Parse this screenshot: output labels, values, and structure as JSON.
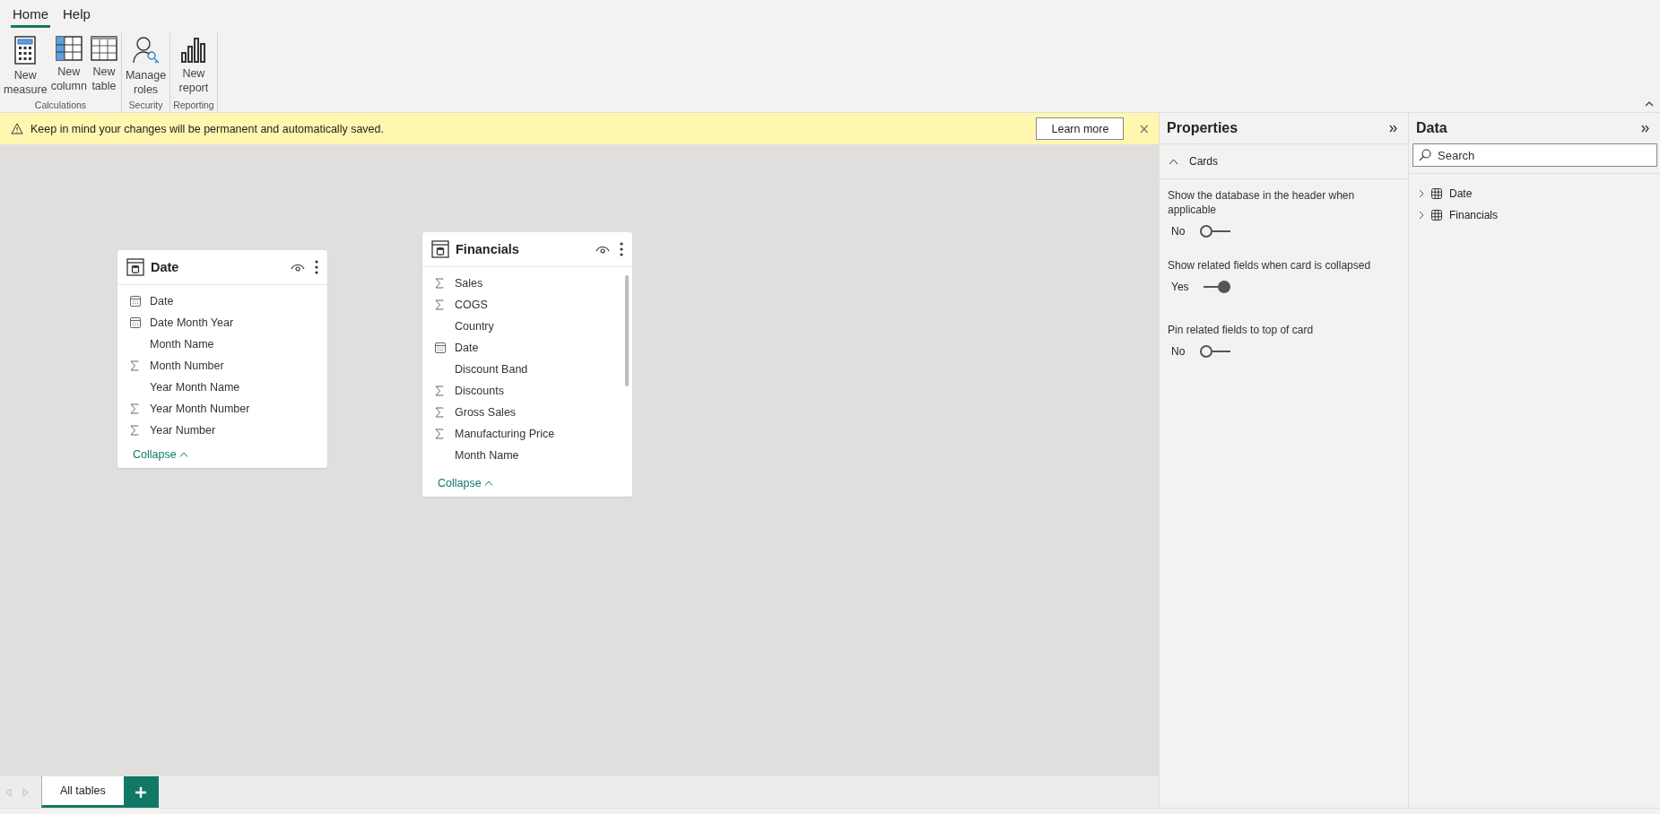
{
  "ribbon": {
    "tabs": [
      {
        "label": "Home",
        "selected": true
      },
      {
        "label": "Help",
        "selected": false
      }
    ],
    "groups": [
      {
        "name": "Calculations",
        "buttons": [
          {
            "label": "New measure"
          },
          {
            "label": "New column"
          },
          {
            "label": "New table"
          }
        ]
      },
      {
        "name": "Security",
        "buttons": [
          {
            "label": "Manage roles"
          }
        ]
      },
      {
        "name": "Reporting",
        "buttons": [
          {
            "label": "New report"
          }
        ]
      }
    ]
  },
  "banner": {
    "message": "Keep in mind your changes will be permanent and automatically saved.",
    "button": "Learn more",
    "close": "×"
  },
  "cards": [
    {
      "title": "Date",
      "fields": [
        {
          "name": "Date",
          "kind": "date"
        },
        {
          "name": "Date Month Year",
          "kind": "date"
        },
        {
          "name": "Month Name",
          "kind": "text"
        },
        {
          "name": "Month Number",
          "kind": "measure"
        },
        {
          "name": "Year Month Name",
          "kind": "text"
        },
        {
          "name": "Year Month Number",
          "kind": "measure"
        },
        {
          "name": "Year Number",
          "kind": "measure"
        }
      ],
      "collapse": "Collapse"
    },
    {
      "title": "Financials",
      "fields": [
        {
          "name": "Sales",
          "kind": "measure"
        },
        {
          "name": "COGS",
          "kind": "measure"
        },
        {
          "name": "Country",
          "kind": "text"
        },
        {
          "name": "Date",
          "kind": "date"
        },
        {
          "name": "Discount Band",
          "kind": "text"
        },
        {
          "name": "Discounts",
          "kind": "measure"
        },
        {
          "name": "Gross Sales",
          "kind": "measure"
        },
        {
          "name": "Manufacturing Price",
          "kind": "measure"
        },
        {
          "name": "Month Name",
          "kind": "text"
        }
      ],
      "collapse": "Collapse"
    }
  ],
  "layout_tabs": [
    {
      "label": "All tables",
      "selected": true
    }
  ],
  "properties": {
    "title": "Properties",
    "section": {
      "label": "Cards",
      "expanded": true
    },
    "settings": [
      {
        "label": "Show the database in the header when applicable",
        "value": "No",
        "on": false
      },
      {
        "label": "Show related fields when card is collapsed",
        "value": "Yes",
        "on": true
      },
      {
        "label": "Pin related fields to top of card",
        "value": "No",
        "on": false
      }
    ]
  },
  "data": {
    "title": "Data",
    "search": {
      "placeholder": "Search"
    },
    "tables": [
      {
        "name": "Date",
        "expanded": false
      },
      {
        "name": "Financials",
        "expanded": false
      }
    ]
  }
}
